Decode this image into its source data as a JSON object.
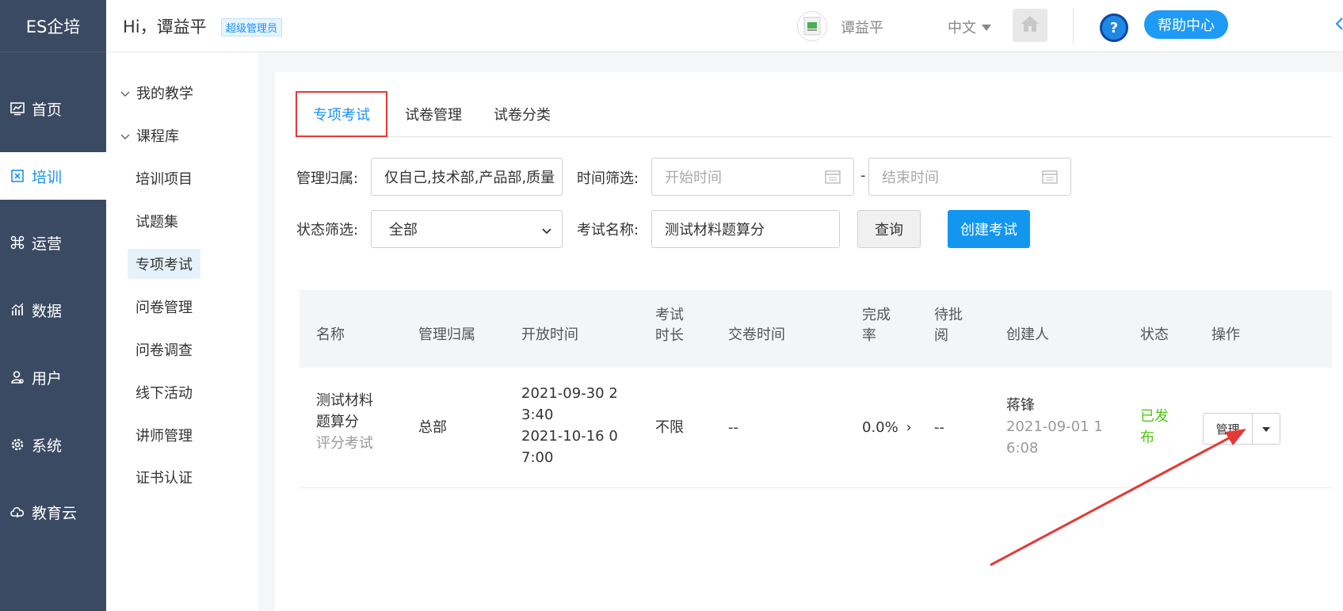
{
  "brand": "ES企培",
  "main_nav": [
    {
      "label": "首页",
      "icon": "dashboard-icon"
    },
    {
      "label": "培训",
      "icon": "book-icon"
    },
    {
      "label": "运营",
      "icon": "command-icon"
    },
    {
      "label": "数据",
      "icon": "chart-icon"
    },
    {
      "label": "用户",
      "icon": "user-icon"
    },
    {
      "label": "系统",
      "icon": "gear-icon"
    },
    {
      "label": "教育云",
      "icon": "cloud-icon"
    }
  ],
  "header": {
    "greeting": "Hi，谭益平",
    "role_badge": "超级管理员",
    "user_name": "谭益平",
    "language": "中文",
    "help_label": "帮助中心",
    "help_q": "?"
  },
  "sub_nav": {
    "groups": [
      "我的教学",
      "课程库"
    ],
    "items": [
      "培训项目",
      "试题集",
      "专项考试",
      "问卷管理",
      "问卷调查",
      "线下活动",
      "讲师管理",
      "证书认证"
    ]
  },
  "tabs": [
    "专项考试",
    "试卷管理",
    "试卷分类"
  ],
  "filters": {
    "owner_label": "管理归属:",
    "owner_value": "仅自己,技术部,产品部,质量",
    "time_label": "时间筛选:",
    "start_placeholder": "开始时间",
    "end_placeholder": "结束时间",
    "range_sep": "-",
    "status_label": "状态筛选:",
    "status_value": "全部",
    "name_label": "考试名称:",
    "name_value": "测试材料题算分",
    "query_button": "查询",
    "create_button": "创建考试"
  },
  "table": {
    "headers": {
      "name": "名称",
      "owner": "管理归属",
      "open_time": "开放时间",
      "duration_1": "考试",
      "duration_2": "时长",
      "submit_time": "交卷时间",
      "completion_1": "完成",
      "completion_2": "率",
      "pending_1": "待批",
      "pending_2": "阅",
      "creator": "创建人",
      "status": "状态",
      "action": "操作"
    },
    "rows": [
      {
        "name_1": "测试材料",
        "name_2": "题算分",
        "type": "评分考试",
        "owner": "总部",
        "open_1": "2021-09-30 2",
        "open_2": "3:40",
        "open_3": "2021-10-16 0",
        "open_4": "7:00",
        "duration": "不限",
        "submit_time": "--",
        "completion": "0.0%",
        "completion_arrow": "›",
        "pending": "--",
        "creator": "蒋锋",
        "created_1": "2021-09-01 1",
        "created_2": "6:08",
        "status_1": "已发",
        "status_2": "布",
        "manage_label": "管理"
      }
    ]
  },
  "colors": {
    "nav_bg": "#3b4a63",
    "accent": "#1890ff",
    "published_green": "#52c41a",
    "annotation_red": "#e53935"
  }
}
